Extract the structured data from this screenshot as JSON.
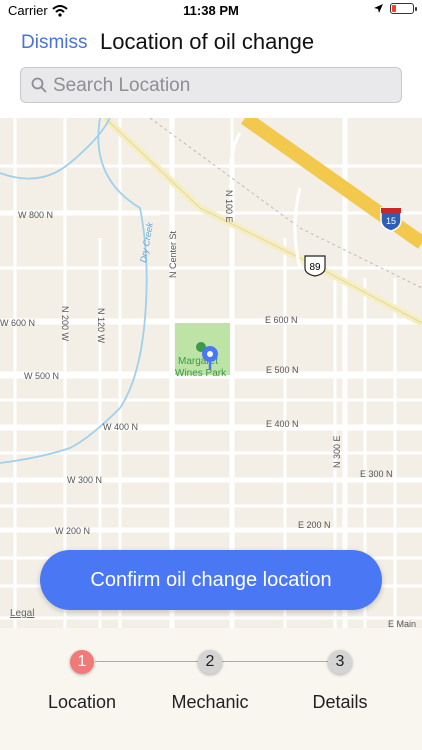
{
  "status_bar": {
    "carrier": "Carrier",
    "time": "11:38 PM"
  },
  "nav": {
    "dismiss_label": "Dismiss",
    "title": "Location of oil change"
  },
  "search": {
    "placeholder": "Search Location",
    "value": ""
  },
  "map": {
    "streets": {
      "w800n": "W 800 N",
      "w600n": "W 600 N",
      "e600n": "E 600 N",
      "w500n": "W 500 N",
      "e500n": "E 500 N",
      "w400n": "W 400 N",
      "e400n": "E 400 N",
      "w300n": "W 300 N",
      "e300n": "E 300 N",
      "w200n": "W 200 N",
      "e200n": "E 200 N",
      "n_center": "N Center St",
      "n100e": "N 100 E",
      "n200w": "N 200 W",
      "n120w": "N 120 W",
      "n300e": "N 300 E",
      "e_main": "E Main"
    },
    "creek": "Dry Creek",
    "park": [
      "Margaret",
      "Wines Park"
    ],
    "interstate": "15",
    "highway": "89",
    "legal": "Legal"
  },
  "confirm_label": "Confirm oil change location",
  "steps": [
    {
      "number": "1",
      "label": "Location",
      "active": true
    },
    {
      "number": "2",
      "label": "Mechanic",
      "active": false
    },
    {
      "number": "3",
      "label": "Details",
      "active": false
    }
  ],
  "colors": {
    "accent": "#4a78f5",
    "step_active": "#f07a78",
    "link": "#4a72d9"
  }
}
